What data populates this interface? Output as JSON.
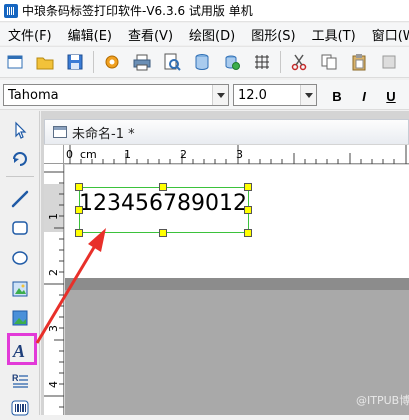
{
  "window": {
    "title": "中琅条码标签打印软件-V6.3.6 试用版 单机"
  },
  "menu": {
    "items": [
      "文件(F)",
      "编辑(E)",
      "查看(V)",
      "绘图(D)",
      "图形(S)",
      "工具(T)",
      "窗口(W"
    ]
  },
  "fontbar": {
    "font_name": "Tahoma",
    "font_size": "12.0",
    "bold_label": "B",
    "italic_label": "I",
    "underline_label": "U"
  },
  "document": {
    "tab_title": "未命名-1 *"
  },
  "ruler": {
    "unit": "cm",
    "top_numbers": [
      "0",
      "1",
      "2",
      "3"
    ],
    "left_numbers": [
      "1",
      "2",
      "3",
      "4"
    ]
  },
  "canvas": {
    "text_object_value": "123456789012"
  },
  "watermark": {
    "text": "@ITPUB博客"
  },
  "colors": {
    "highlight": "#e23ad8",
    "arrow": "#e8302a",
    "selection_border": "#3bc23b",
    "handle": "#ffff00"
  }
}
